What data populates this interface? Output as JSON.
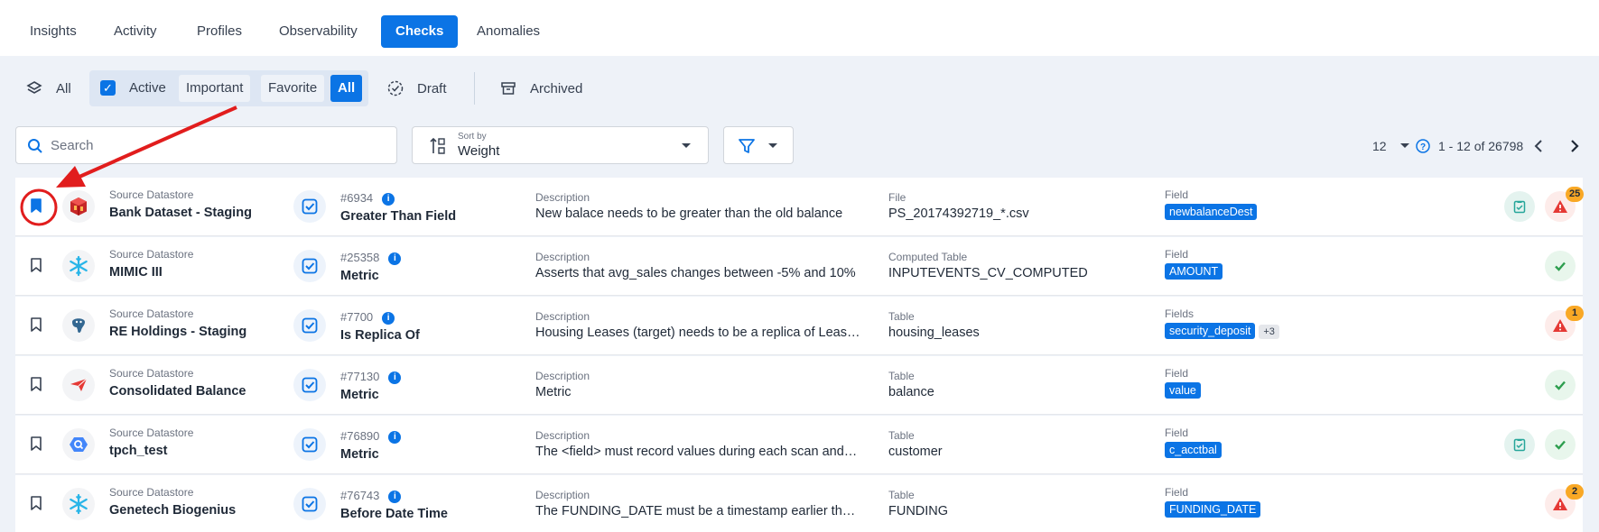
{
  "tabs": [
    {
      "label": "Insights"
    },
    {
      "label": "Activity"
    },
    {
      "label": "Profiles"
    },
    {
      "label": "Observability"
    },
    {
      "label": "Checks"
    },
    {
      "label": "Anomalies"
    }
  ],
  "filters": {
    "all": "All",
    "active": "Active",
    "important": "Important",
    "favorite": "Favorite",
    "all_selected": "All",
    "draft": "Draft",
    "archived": "Archived"
  },
  "search": {
    "placeholder": "Search"
  },
  "sort": {
    "label": "Sort by",
    "value": "Weight"
  },
  "pagination": {
    "page_size": "12",
    "range": "1 - 12 of 26798"
  },
  "rows": [
    {
      "ds_label": "Source Datastore",
      "ds_name": "Bank Dataset - Staging",
      "ds_icon": "database-icon",
      "check_id": "#6934",
      "check_type": "Greater Than Field",
      "desc_label": "Description",
      "desc": "New balace needs to be greater than the old balance",
      "container_label": "File",
      "container": "PS_20174392719_*.csv",
      "field_label": "Field",
      "field": "newbalanceDest",
      "field_more": "",
      "status": "warn",
      "badge": "25",
      "flag": true,
      "bookmarked": true
    },
    {
      "ds_label": "Source Datastore",
      "ds_name": "MIMIC III",
      "ds_icon": "snowflake-icon",
      "check_id": "#25358",
      "check_type": "Metric",
      "desc_label": "Description",
      "desc": "Asserts that avg_sales changes between -5% and 10%",
      "container_label": "Computed Table",
      "container": "INPUTEVENTS_CV_COMPUTED",
      "field_label": "Field",
      "field": "AMOUNT",
      "field_more": "",
      "status": "ok",
      "badge": "",
      "flag": false,
      "bookmarked": false
    },
    {
      "ds_label": "Source Datastore",
      "ds_name": "RE Holdings - Staging",
      "ds_icon": "postgres-icon",
      "check_id": "#7700",
      "check_type": "Is Replica Of",
      "desc_label": "Description",
      "desc": "Housing Leases (target) needs to be a replica of Leases (source)",
      "container_label": "Table",
      "container": "housing_leases",
      "field_label": "Fields",
      "field": "security_deposit",
      "field_more": "+3",
      "status": "warn",
      "badge": "1",
      "flag": false,
      "bookmarked": false
    },
    {
      "ds_label": "Source Datastore",
      "ds_name": "Consolidated Balance",
      "ds_icon": "paper-plane-icon",
      "check_id": "#77130",
      "check_type": "Metric",
      "desc_label": "Description",
      "desc": "Metric",
      "container_label": "Table",
      "container": "balance",
      "field_label": "Field",
      "field": "value",
      "field_more": "",
      "status": "ok",
      "badge": "",
      "flag": false,
      "bookmarked": false
    },
    {
      "ds_label": "Source Datastore",
      "ds_name": "tpch_test",
      "ds_icon": "bigquery-icon",
      "check_id": "#76890",
      "check_type": "Metric",
      "desc_label": "Description",
      "desc": "The <field> must record values during each scan and across all",
      "container_label": "Table",
      "container": "customer",
      "field_label": "Field",
      "field": "c_acctbal",
      "field_more": "",
      "status": "ok",
      "badge": "",
      "flag": true,
      "bookmarked": false
    },
    {
      "ds_label": "Source Datastore",
      "ds_name": "Genetech Biogenius",
      "ds_icon": "snowflake-icon",
      "check_id": "#76743",
      "check_type": "Before Date Time",
      "desc_label": "Description",
      "desc": "The FUNDING_DATE must be a timestamp earlier than the date",
      "container_label": "Table",
      "container": "FUNDING",
      "field_label": "Field",
      "field": "FUNDING_DATE",
      "field_more": "",
      "status": "warn",
      "badge": "2",
      "flag": false,
      "bookmarked": false
    }
  ],
  "colors": {
    "accent": "#0b74e5",
    "ok": "#2e9e4f",
    "warn": "#e53935",
    "badge": "#f9a825",
    "annotation": "#e11d1d"
  }
}
